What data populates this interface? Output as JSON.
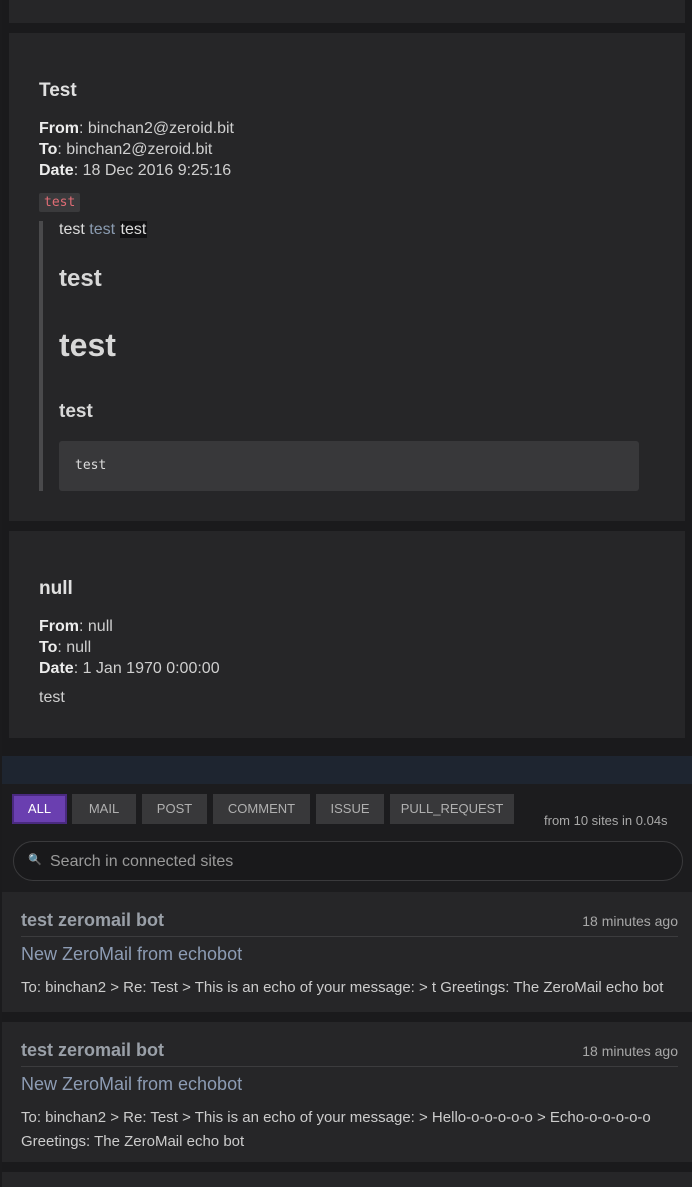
{
  "mails": [
    {
      "title": "Test",
      "from_label": "From",
      "from": "binchan2@zeroid.bit",
      "to_label": "To",
      "to": "binchan2@zeroid.bit",
      "date_label": "Date",
      "date": "18 Dec 2016 9:25:16",
      "tag": "test",
      "quote": {
        "line_a": "test",
        "line_link": "test",
        "line_highlight": "test",
        "h2": "test",
        "h1": "test",
        "h3": "test",
        "code": "test"
      }
    },
    {
      "title": "null",
      "from_label": "From",
      "from": "null",
      "to_label": "To",
      "to": "null",
      "date_label": "Date",
      "date": "1 Jan 1970 0:00:00",
      "body": "test"
    }
  ],
  "search": {
    "tabs": [
      "ALL",
      "MAIL",
      "POST",
      "COMMENT",
      "ISSUE",
      "PULL_REQUEST"
    ],
    "active_tab": "ALL",
    "stats": "from 10 sites in 0.04s",
    "placeholder": "Search in connected sites",
    "icon": "search-icon"
  },
  "results": [
    {
      "title": "test zeromail bot",
      "time": "18 minutes ago",
      "subtitle": "New ZeroMail from echobot",
      "body": "To: binchan2 > Re: Test > This is an echo of your message: > t Greetings: The ZeroMail echo bot"
    },
    {
      "title": "test zeromail bot",
      "time": "18 minutes ago",
      "subtitle": "New ZeroMail from echobot",
      "body": "To: binchan2 > Re: Test > This is an echo of your message: > Hello-o-o-o-o-o > Echo-o-o-o-o-o Greetings: The ZeroMail echo bot"
    }
  ]
}
